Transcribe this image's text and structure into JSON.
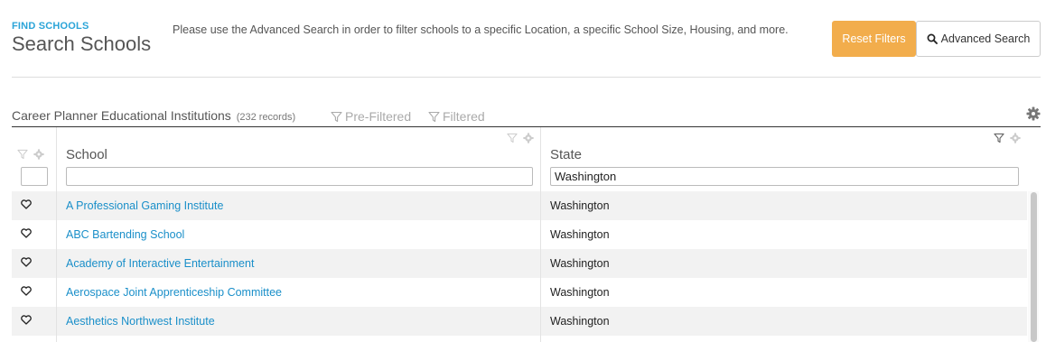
{
  "header": {
    "eyebrow": "FIND SCHOOLS",
    "title": "Search Schools",
    "help_text": "Please use the Advanced Search in order to filter schools to a specific Location, a specific School Size, Housing, and more.",
    "reset_label": "Reset Filters",
    "advanced_label": "Advanced Search"
  },
  "grid": {
    "title": "Career Planner Educational Institutions",
    "records": "(232 records)",
    "prefiltered_label": "Pre-Filtered",
    "filtered_label": "Filtered",
    "columns": {
      "school": {
        "label": "School",
        "filter_value": ""
      },
      "state": {
        "label": "State",
        "filter_value": "Washington"
      }
    },
    "rows": [
      {
        "school": "A Professional Gaming Institute",
        "state": "Washington"
      },
      {
        "school": "ABC Bartending School",
        "state": "Washington"
      },
      {
        "school": "Academy of Interactive Entertainment",
        "state": "Washington"
      },
      {
        "school": "Aerospace Joint Apprenticeship Committee",
        "state": "Washington"
      },
      {
        "school": "Aesthetics Northwest Institute",
        "state": "Washington"
      }
    ]
  },
  "colors": {
    "accent": "#2aa4d8",
    "link": "#1a8fc9",
    "reset": "#f2ad4c"
  },
  "icons": [
    "search-icon",
    "filter-icon",
    "gear-icon",
    "heart-icon"
  ]
}
